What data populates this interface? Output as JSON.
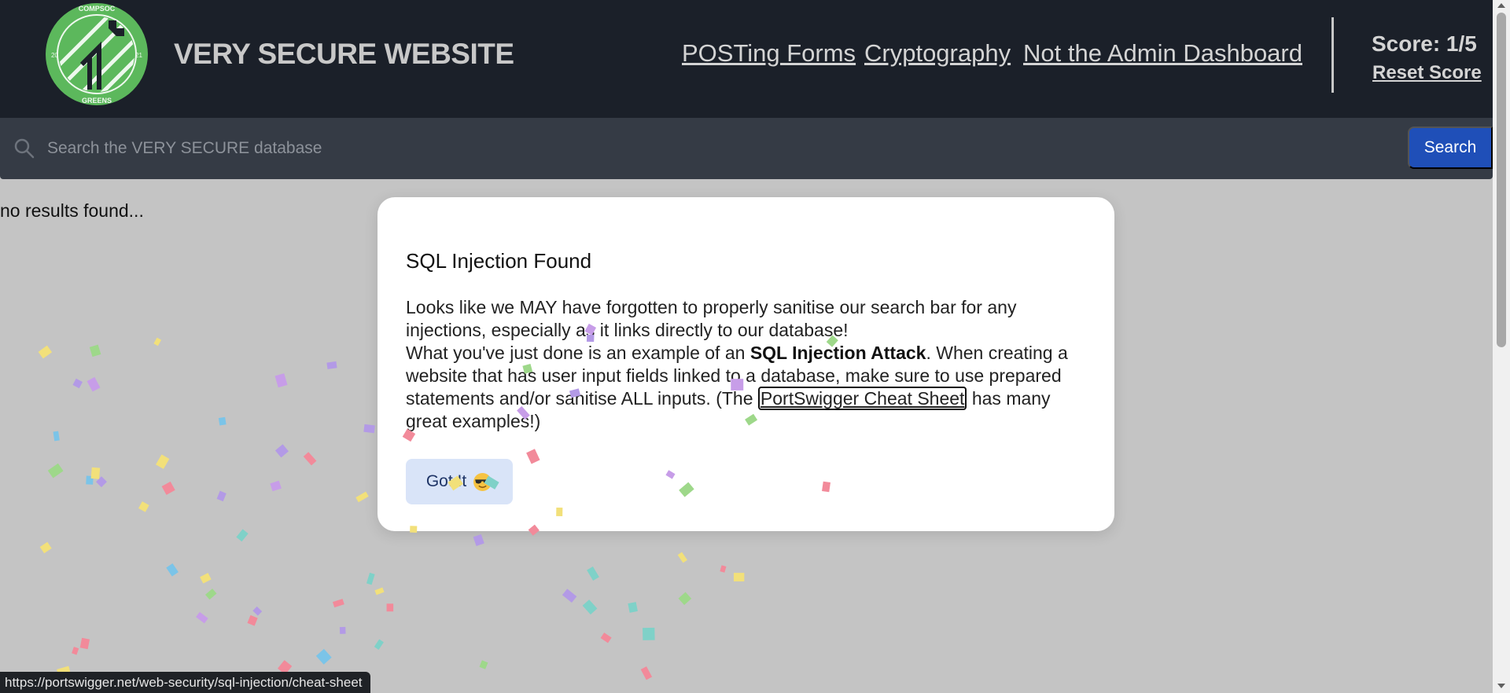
{
  "colors": {
    "header_bg": "#1b2029",
    "searchbar_bg": "#353b45",
    "search_button": "#1f4fb8",
    "page_bg": "#c4c4c4",
    "logo_green": "#5cb85c"
  },
  "header": {
    "logo_text_top": "COMPSOC",
    "logo_text_bottom": "GREENS",
    "logo_year_left": "20",
    "logo_year_right": "21",
    "title": "VERY SECURE WEBSITE",
    "nav": [
      "POSTing Forms",
      "Cryptography",
      "Not the Admin Dashboard"
    ],
    "score": "Score: 1/5",
    "reset": "Reset Score"
  },
  "search": {
    "placeholder": "Search the VERY SECURE database",
    "button": "Search",
    "icon": "search-icon"
  },
  "results": {
    "message": "no results found..."
  },
  "modal": {
    "title": "SQL Injection Found",
    "line1": "Looks like we MAY have forgotten to properly sanitise our search bar for any injections, especially as it links directly to our database!",
    "line2_pre": "What you've just done is an example of an ",
    "line2_bold": "SQL Injection Attack",
    "line2_post": ". When creating a website that has user input fields linked to a database, make sure to use prepared statements and/or sanitise ALL inputs. (The ",
    "link_text": "PortSwigger Cheat Sheet",
    "line2_end": " has many great examples!)",
    "button": "Got It",
    "button_icon": "sunglasses-emoji-icon"
  },
  "status_bar": {
    "url": "https://portswigger.net/web-security/sql-injection/cheat-sheet"
  }
}
